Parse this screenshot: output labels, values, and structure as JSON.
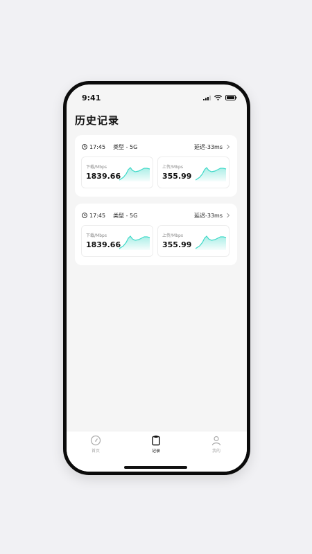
{
  "status_bar": {
    "time": "9:41"
  },
  "page": {
    "title": "历史记录"
  },
  "records": [
    {
      "time": "17:45",
      "type": "类型 - 5G",
      "latency": "延迟-33ms",
      "download": {
        "label": "下载/Mbps",
        "value": "1839.66"
      },
      "upload": {
        "label": "上传/Mbps",
        "value": "355.99"
      }
    },
    {
      "time": "17:45",
      "type": "类型 - 5G",
      "latency": "延迟-33ms",
      "download": {
        "label": "下载/Mbps",
        "value": "1839.66"
      },
      "upload": {
        "label": "上传/Mbps",
        "value": "355.99"
      }
    }
  ],
  "tabs": [
    {
      "label": "首页",
      "icon": "speedometer-icon",
      "active": false
    },
    {
      "label": "记录",
      "icon": "clipboard-icon",
      "active": true
    },
    {
      "label": "我的",
      "icon": "user-icon",
      "active": false
    }
  ],
  "colors": {
    "accent": "#3fd9c8",
    "background": "#f5f5f5",
    "card": "#ffffff"
  }
}
